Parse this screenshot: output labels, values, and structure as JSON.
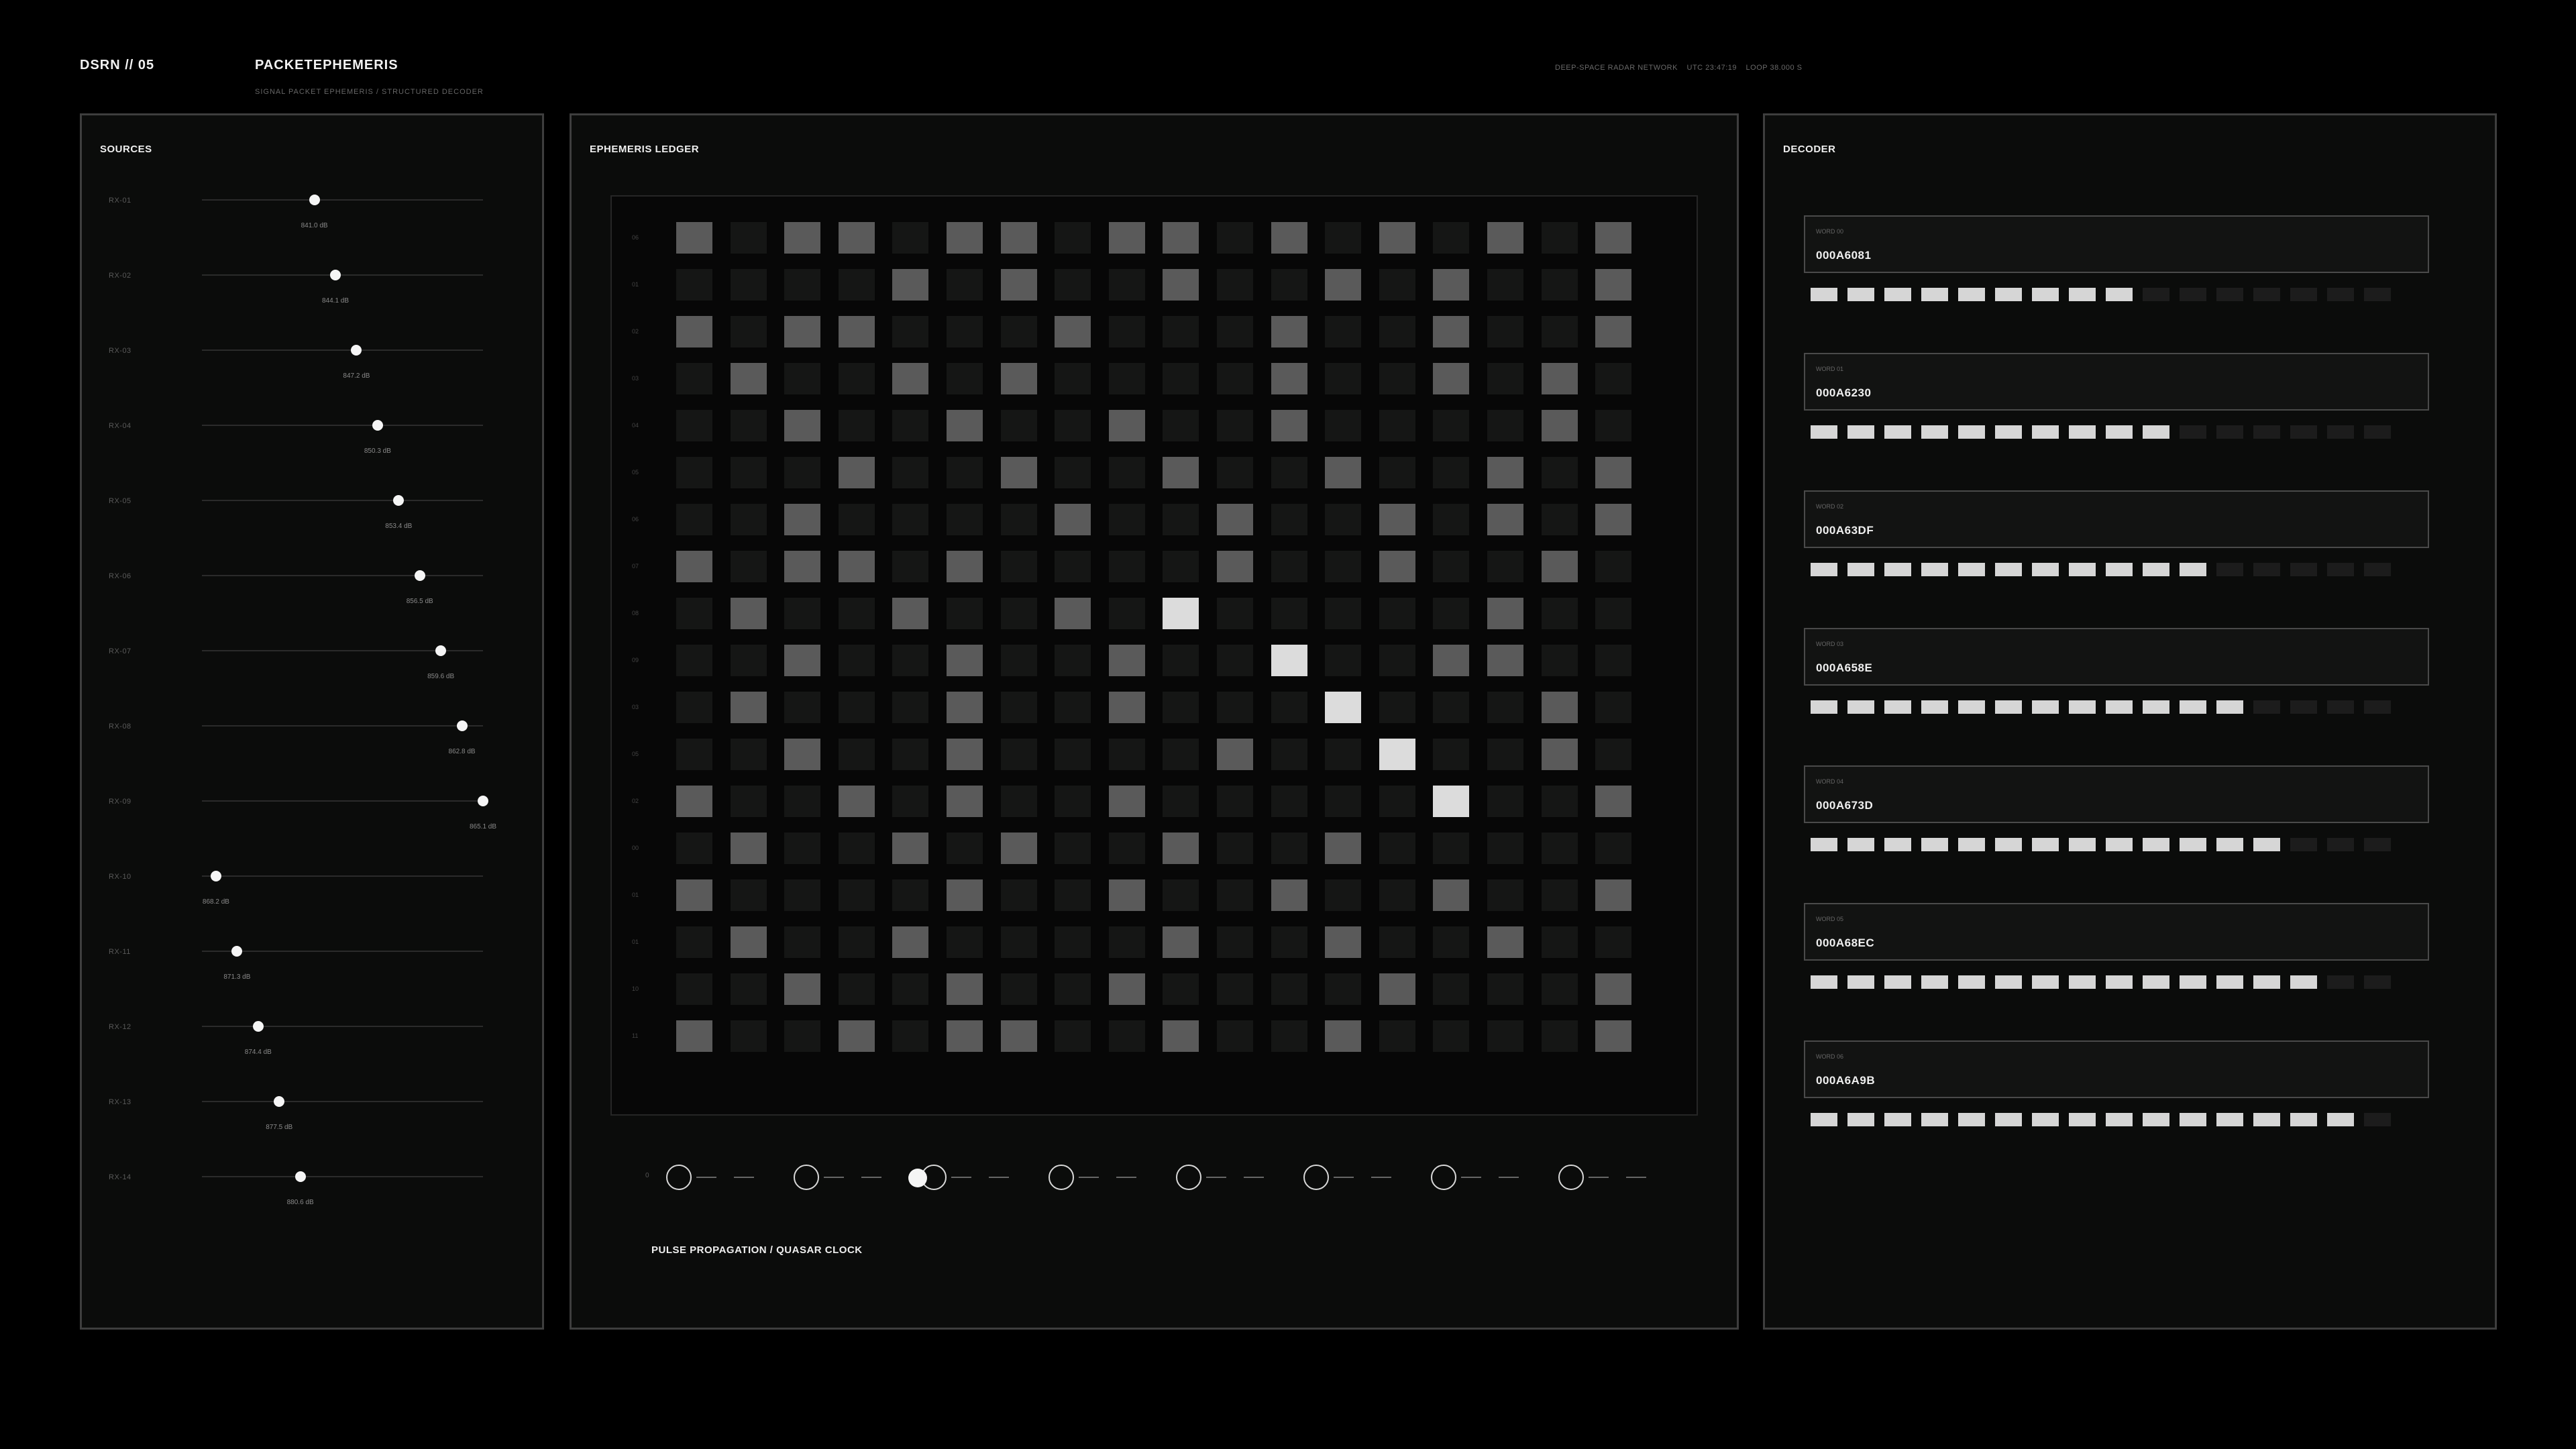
{
  "header": {
    "brand": "DSRN // 05",
    "title": "PACKETEPHEMERIS",
    "subtitle": "SIGNAL PACKET EPHEMERIS / STRUCTURED DECODER",
    "status": [
      "DEEP-SPACE RADAR NETWORK",
      "UTC 23:47:19",
      "LOOP 38.000 S"
    ]
  },
  "sources": {
    "title": "SOURCES",
    "items": [
      {
        "label": "RX-01",
        "value": "841.0 dB",
        "level": 0.4
      },
      {
        "label": "RX-02",
        "value": "844.1 dB",
        "level": 0.475
      },
      {
        "label": "RX-03",
        "value": "847.2 dB",
        "level": 0.55
      },
      {
        "label": "RX-04",
        "value": "850.3 dB",
        "level": 0.625
      },
      {
        "label": "RX-05",
        "value": "853.4 dB",
        "level": 0.7
      },
      {
        "label": "RX-06",
        "value": "856.5 dB",
        "level": 0.775
      },
      {
        "label": "RX-07",
        "value": "859.6 dB",
        "level": 0.85
      },
      {
        "label": "RX-08",
        "value": "862.8 dB",
        "level": 0.925
      },
      {
        "label": "RX-09",
        "value": "865.1 dB",
        "level": 1.0
      },
      {
        "label": "RX-10",
        "value": "868.2 dB",
        "level": 0.05
      },
      {
        "label": "RX-11",
        "value": "871.3 dB",
        "level": 0.125
      },
      {
        "label": "RX-12",
        "value": "874.4 dB",
        "level": 0.2
      },
      {
        "label": "RX-13",
        "value": "877.5 dB",
        "level": 0.275
      },
      {
        "label": "RX-14",
        "value": "880.6 dB",
        "level": 0.35
      }
    ]
  },
  "ledger": {
    "title": "EPHEMERIS LEDGER",
    "row_labels": [
      "06",
      "01",
      "02",
      "03",
      "04",
      "05",
      "06",
      "07",
      "08",
      "09",
      "03",
      "05",
      "02",
      "00",
      "01",
      "01",
      "10",
      "11"
    ],
    "grid": [
      "101101101101010101",
      "000010100100101001",
      "101100010001001001",
      "010010100001001010",
      "001001001001000010",
      "000100100100100101",
      "001000010010010101",
      "101101000010010010",
      "010010010200000100",
      "001001001002001100",
      "010001001000200010",
      "001001000010020010",
      "100101001000002001",
      "010010100100100000",
      "100001001001001001",
      "010010000100100100",
      "001001001000010001",
      "100101100100100001"
    ],
    "timeline_start": "0",
    "timeline_caption": "PULSE PROPAGATION / QUASAR CLOCK",
    "timeline_active_node": 2
  },
  "decoder": {
    "title": "DECODER",
    "words": [
      {
        "label": "WORD 00",
        "value": "000A6081",
        "bits_on": 9
      },
      {
        "label": "WORD 01",
        "value": "000A6230",
        "bits_on": 10
      },
      {
        "label": "WORD 02",
        "value": "000A63DF",
        "bits_on": 11
      },
      {
        "label": "WORD 03",
        "value": "000A658E",
        "bits_on": 12
      },
      {
        "label": "WORD 04",
        "value": "000A673D",
        "bits_on": 13
      },
      {
        "label": "WORD 05",
        "value": "000A68EC",
        "bits_on": 14
      },
      {
        "label": "WORD 06",
        "value": "000A6A9B",
        "bits_on": 15
      }
    ],
    "bits_total": 16
  },
  "colors": {
    "background": "#000000",
    "panel": "#0b0c0b",
    "cell_off": "#151615",
    "cell_mid": "#5a5a5a",
    "cell_hot": "#dcdcdc",
    "bit_on": "#d6d6d6"
  }
}
